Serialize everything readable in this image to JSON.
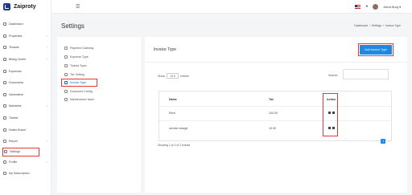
{
  "brand": {
    "name": "Zaiproty"
  },
  "sidebar": {
    "items": [
      {
        "label": "Dashboard",
        "icon": "dashboard-icon",
        "has_chevron": false
      },
      {
        "label": "Properties",
        "icon": "building-icon",
        "has_chevron": true
      },
      {
        "label": "Tenants",
        "icon": "users-icon",
        "has_chevron": true
      },
      {
        "label": "Billing Center",
        "icon": "billing-icon",
        "has_chevron": true
      },
      {
        "label": "Expenses",
        "icon": "expenses-icon",
        "has_chevron": false
      },
      {
        "label": "Documents",
        "icon": "document-icon",
        "has_chevron": false
      },
      {
        "label": "Information",
        "icon": "info-icon",
        "has_chevron": false
      },
      {
        "label": "Maintains",
        "icon": "wrench-icon",
        "has_chevron": true
      },
      {
        "label": "Tickets",
        "icon": "ticket-icon",
        "has_chevron": false
      },
      {
        "label": "Notice Board",
        "icon": "notice-icon",
        "has_chevron": false
      },
      {
        "label": "Report",
        "icon": "report-icon",
        "has_chevron": true
      },
      {
        "label": "Settings",
        "icon": "gear-icon",
        "has_chevron": false,
        "active": true
      },
      {
        "label": "Profile",
        "icon": "user-icon",
        "has_chevron": true
      },
      {
        "label": "My Subscription",
        "icon": "subscription-icon",
        "has_chevron": false
      }
    ]
  },
  "topbar": {
    "user_name": "Alexa Burg",
    "user_chevron": "▾",
    "menu_glyph": "☰",
    "bell_glyph": "🔔"
  },
  "header": {
    "title": "Settings",
    "breadcrumb": [
      "Dashboard",
      "/",
      "Settings",
      "/",
      "Invoice Type"
    ]
  },
  "settings_menu": {
    "items": [
      {
        "label": "Payment Gateway",
        "icon": "credit-card-icon"
      },
      {
        "label": "Expense Type",
        "icon": "expense-type-icon"
      },
      {
        "label": "Tickets Topic",
        "icon": "topic-icon"
      },
      {
        "label": "Tax Setting",
        "icon": "tax-icon"
      },
      {
        "label": "Invoice Type",
        "icon": "invoice-icon",
        "active": true
      },
      {
        "label": "Document Config",
        "icon": "config-icon"
      },
      {
        "label": "Maintenance Issue",
        "icon": "issue-icon"
      }
    ]
  },
  "panel": {
    "title": "Invoice Type",
    "add_button": "Add Invoice Type",
    "show_label": "Show",
    "page_size": "10",
    "entries_label": "entries",
    "search_label": "Search:",
    "search_value": "",
    "columns": {
      "name": "Name",
      "tax": "Tax",
      "action": "Action"
    },
    "rows": [
      {
        "name": "Rent",
        "tax": "100.00"
      },
      {
        "name": "service charge",
        "tax": "10.00"
      }
    ],
    "info": "Showing 1 to 2 of 2 entries",
    "pager": {
      "prev": "‹",
      "current": "1",
      "next": "›"
    }
  },
  "colors": {
    "accent": "#1e88e5",
    "highlight": "#e53935",
    "brand": "#1e3a8a"
  }
}
